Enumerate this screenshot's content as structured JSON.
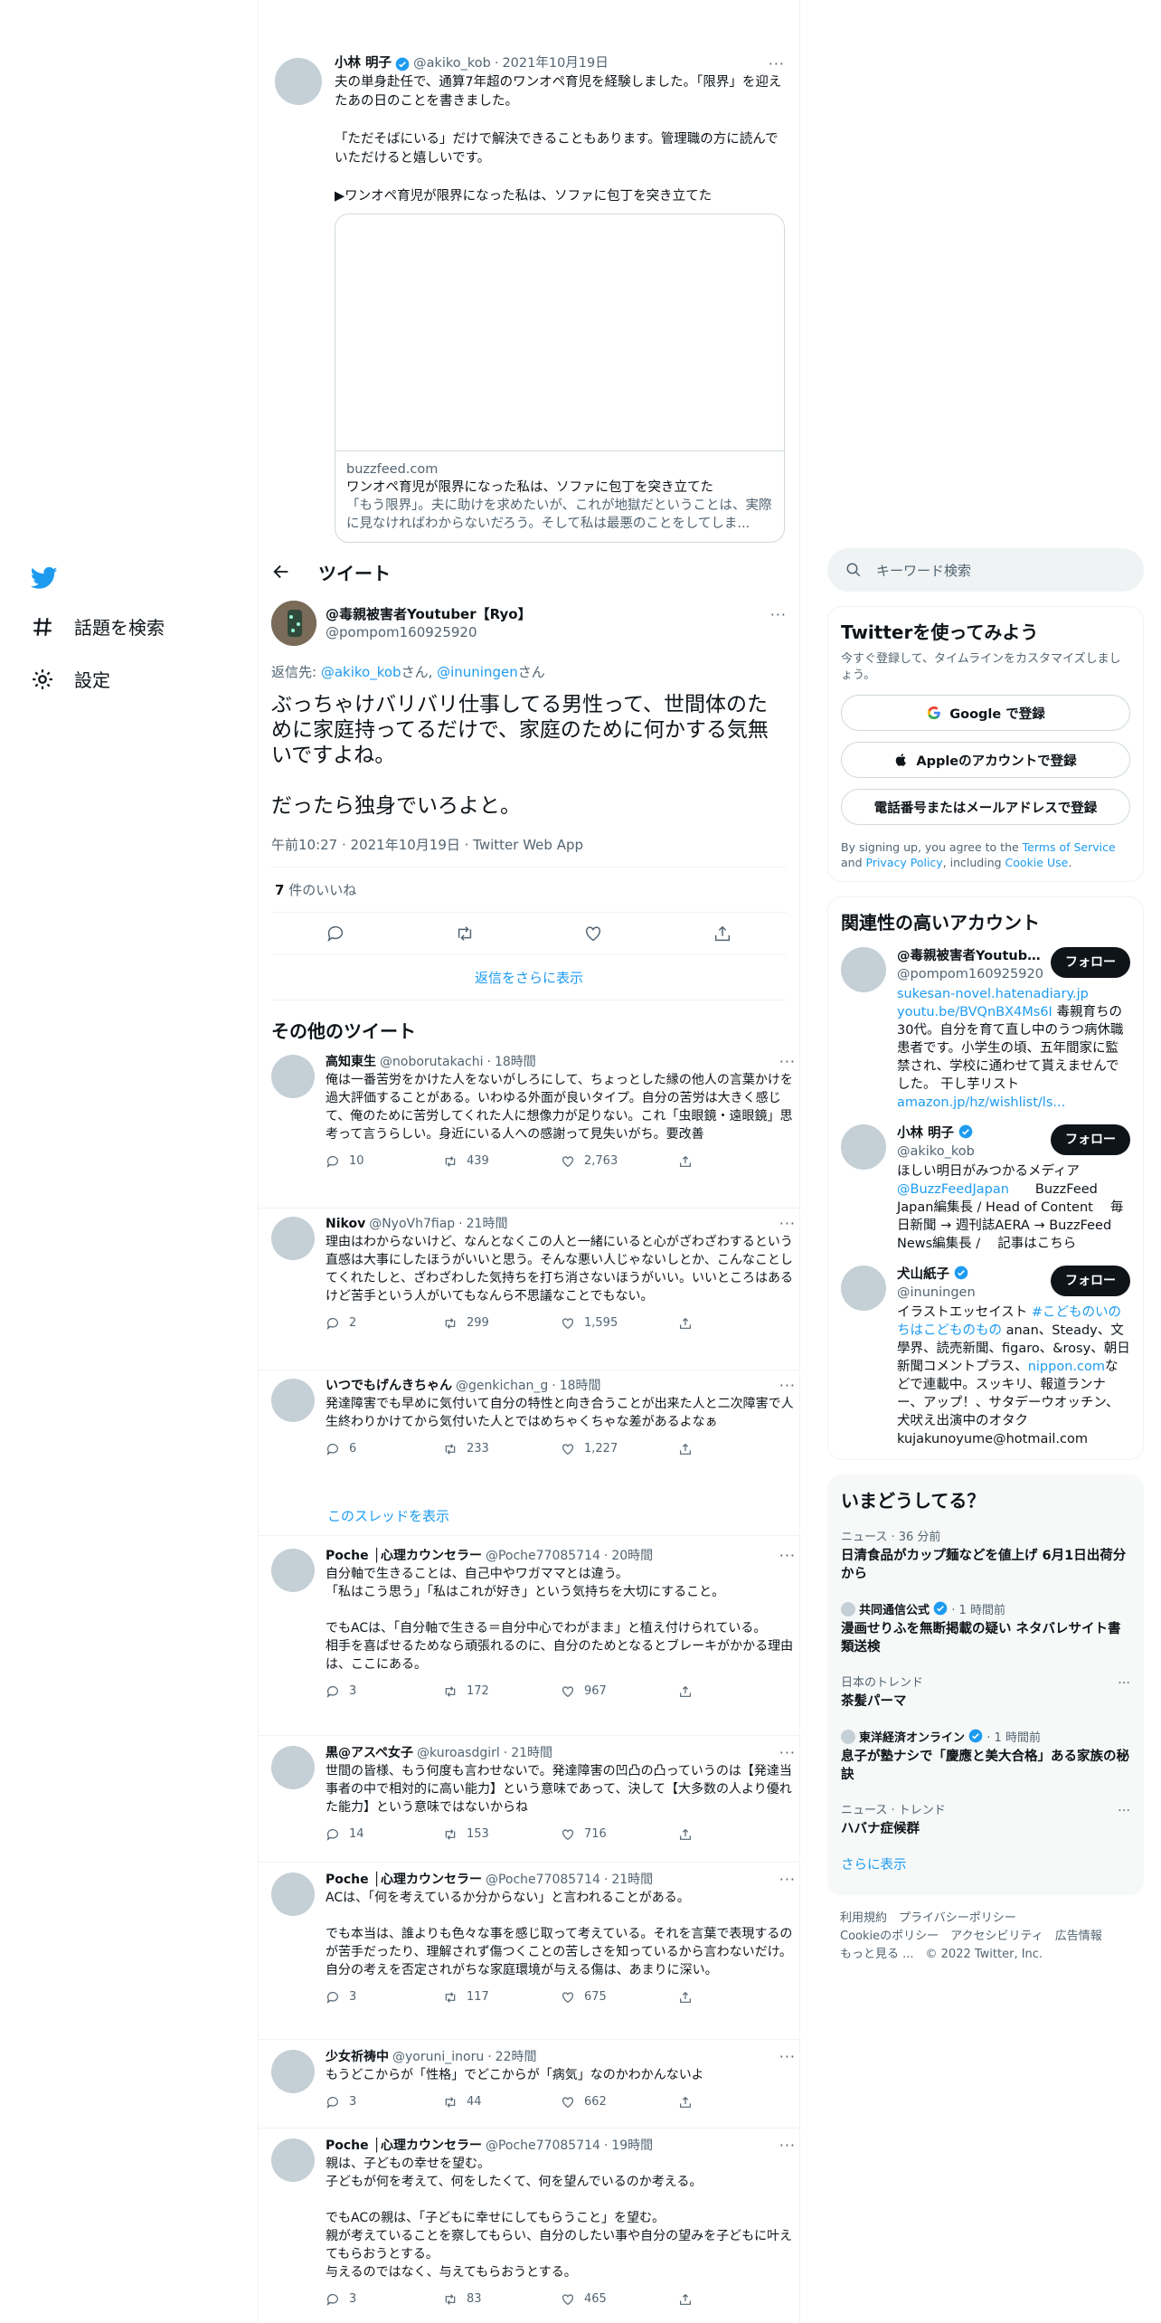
{
  "nav": {
    "explore_label": "話題を検索",
    "settings_label": "設定"
  },
  "quoted": {
    "name": "小林 明子",
    "handle": "@akiko_kob",
    "date": "2021年10月19日",
    "p1": "夫の単身赴任で、通算7年超のワンオペ育児を経験しました。「限界」を迎えたあの日のことを書きました。",
    "p2": "「ただそばにいる」だけで解決できることもあります。管理職の方に読んでいただけると嬉しいです。",
    "p3": "▶ワンオペ育児が限界になった私は、ソファに包丁を突き立てた",
    "card": {
      "domain": "buzzfeed.com",
      "title": "ワンオペ育児が限界になった私は、ソファに包丁を突き立てた",
      "desc": "「もう限界」。夫に助けを求めたいが、これが地獄だということは、実際に見なければわからないだろう。そして私は最悪のことをしてしま..."
    }
  },
  "header": {
    "title": "ツイート"
  },
  "main": {
    "name": "@毒親被害者Youtuber【Ryo】",
    "handle": "@pompom160925920",
    "reply_prefix": "返信先: ",
    "reply_user1": "@akiko_kob",
    "reply_mid": "さん, ",
    "reply_user2": "@inuningen",
    "reply_suffix": "さん",
    "text1": "ぶっちゃけバリバリ仕事してる男性って、世間体のために家庭持ってるだけで、家庭のために何かする気無いですよね。",
    "text2": "だったら独身でいろよと。",
    "meta": "午前10:27 · 2021年10月19日 · Twitter Web App",
    "likes_count": "7",
    "likes_label": " 件のいいね",
    "show_more": "返信をさらに表示",
    "others_title": "その他のツイート"
  },
  "tweets": [
    {
      "name": "高知東生",
      "handle": "@noborutakachi",
      "time": "18時間",
      "text": "俺は一番苦労をかけた人をないがしろにして、ちょっとした縁の他人の言葉かけを過大評価することがある。いわゆる外面が良いタイプ。自分の苦労は大きく感じて、俺のために苦労してくれた人に想像力が足りない。これ「虫眼鏡・遠眼鏡」思考って言うらしい。身近にいる人への感謝って見失いがち。要改善",
      "replies": "10",
      "retweets": "439",
      "likes": "2,763"
    },
    {
      "name": "Nikov",
      "handle": "@NyoVh7fiap",
      "time": "21時間",
      "text": "理由はわからないけど、なんとなくこの人と一緒にいると心がざわざわするという直感は大事にしたほうがいいと思う。そんな悪い人じゃないしとか、こんなことしてくれたしと、ざわざわした気持ちを打ち消さないほうがいい。いいところはあるけど苦手という人がいてもなんら不思議なことでもない。",
      "replies": "2",
      "retweets": "299",
      "likes": "1,595"
    },
    {
      "name": "いつでもげんきちゃん",
      "handle": "@genkichan_g",
      "time": "18時間",
      "text": "発達障害でも早めに気付いて自分の特性と向き合うことが出来た人と二次障害で人生終わりかけてから気付いた人とではめちゃくちゃな差があるよなぁ",
      "replies": "6",
      "retweets": "233",
      "likes": "1,227",
      "thread": "このスレッドを表示"
    },
    {
      "name": "Poche │心理カウンセラー",
      "handle": "@Poche77085714",
      "time": "20時間",
      "text": "自分軸で生きることは、自己中やワガママとは違う。\n「私はこう思う」「私はこれが好き」という気持ちを大切にすること。\n\nでもACは、「自分軸で生きる＝自分中心でわがまま」と植え付けられている。\n相手を喜ばせるためなら頑張れるのに、自分のためとなるとブレーキがかかる理由は、ここにある。",
      "replies": "3",
      "retweets": "172",
      "likes": "967"
    },
    {
      "name": "黒@アスペ女子",
      "handle": "@kuroasdgirl",
      "time": "21時間",
      "text": "世間の皆様、もう何度も言わせないで。発達障害の凹凸の凸っていうのは【発達当事者の中で相対的に高い能力】という意味であって、決して【大多数の人より優れた能力】という意味ではないからね",
      "replies": "14",
      "retweets": "153",
      "likes": "716"
    },
    {
      "name": "Poche │心理カウンセラー",
      "handle": "@Poche77085714",
      "time": "21時間",
      "text": "ACは、「何を考えているか分からない」と言われることがある。\n\nでも本当は、誰よりも色々な事を感じ取って考えている。それを言葉で表現するのが苦手だったり、理解されず傷つくことの苦しさを知っているから言わないだけ。\n自分の考えを否定されがちな家庭環境が与える傷は、あまりに深い。",
      "replies": "3",
      "retweets": "117",
      "likes": "675"
    },
    {
      "name": "少女祈祷中",
      "handle": "@yoruni_inoru",
      "time": "22時間",
      "text": "もうどこからが「性格」でどこからが「病気」なのかわかんないよ",
      "replies": "3",
      "retweets": "44",
      "likes": "662"
    },
    {
      "name": "Poche │心理カウンセラー",
      "handle": "@Poche77085714",
      "time": "19時間",
      "text": "親は、子どもの幸せを望む。\n子どもが何を考えて、何をしたくて、何を望んでいるのか考える。\n\nでもACの親は、「子どもに幸せにしてもらうこと」を望む。\n親が考えていることを察してもらい、自分のしたい事や自分の望みを子どもに叶えてもらおうとする。\n与えるのではなく、与えてもらおうとする。",
      "replies": "3",
      "retweets": "83",
      "likes": "465"
    }
  ],
  "right": {
    "search_placeholder": "キーワード検索",
    "signup": {
      "title": "Twitterを使ってみよう",
      "subtitle": "今すぐ登録して、タイムラインをカスタマイズしましょう。",
      "google": "Google で登録",
      "apple": "Appleのアカウントで登録",
      "phone": "電話番号またはメールアドレスで登録",
      "legal1": "By signing up, you agree to the ",
      "terms": "Terms of Service",
      "legal2": " and ",
      "privacy": "Privacy Policy",
      "legal3": ", including ",
      "cookie": "Cookie Use",
      "legal4": "."
    },
    "related": {
      "title": "関連性の高いアカウント",
      "follow_label": "フォロー",
      "accounts": [
        {
          "name": "@毒親被害者Youtuber【Ryo】",
          "handle": "@pompom160925920",
          "link1": "sukesan-novel.hatenadiary.jp",
          "link2": "youtu.be/BVQnBX4Ms6I",
          "bio": " 毒親育ちの30代。自分を育て直し中のうつ病休職患者です。小学生の頃、五年間家に監禁され、学校に通わせて貰えませんでした。 干し芋リスト",
          "link3": "amazon.jp/hz/wishlist/ls..."
        },
        {
          "name": "小林 明子",
          "handle": "@akiko_kob",
          "bio1": "ほしい明日がみつかるメディア",
          "link1": "@BuzzFeedJapan",
          "bio2": "　　BuzzFeed Japan編集長 / Head of Content　 毎日新聞 → 週刊誌AERA → BuzzFeed News編集長 /　 記事はこちら"
        },
        {
          "name": "犬山紙子",
          "handle": "@inuningen",
          "bio1": "イラストエッセイスト ",
          "link1": "#こどものいのちはこどものもの",
          "bio2": " anan、Steady、文學界、読売新聞、figaro、&rosy、朝日新聞コメントプラス、",
          "link2": "nippon.com",
          "bio3": "などで連載中。スッキリ、報道ランナー、アップ！、サタデーウオッチン、犬吠え出演中のオタク kujakunoyume@hotmail.com"
        }
      ]
    },
    "trends": {
      "title": "いまどうしてる？",
      "items": [
        {
          "cat": "ニュース · 36 分前",
          "title": "日清食品がカップ麺などを値上げ 6月1日出荷分から"
        },
        {
          "source": "共同通信公式",
          "cat": " · 1 時間前",
          "title": "漫画せりふを無断掲載の疑い ネタバレサイト書類送検"
        },
        {
          "cat": "日本のトレンド",
          "title": "茶髪パーマ"
        },
        {
          "source": "東洋経済オンライン",
          "cat": " · 1 時間前",
          "title": "息子が塾ナシで「慶應と美大合格」ある家族の秘訣"
        },
        {
          "cat": "ニュース · トレンド",
          "title": "ハバナ症候群"
        }
      ],
      "show_more": "さらに表示"
    },
    "footer": "利用規約　プライバシーポリシー\nCookieのポリシー　アクセシビリティ　広告情報\nもっと見る ...　© 2022 Twitter, Inc."
  }
}
